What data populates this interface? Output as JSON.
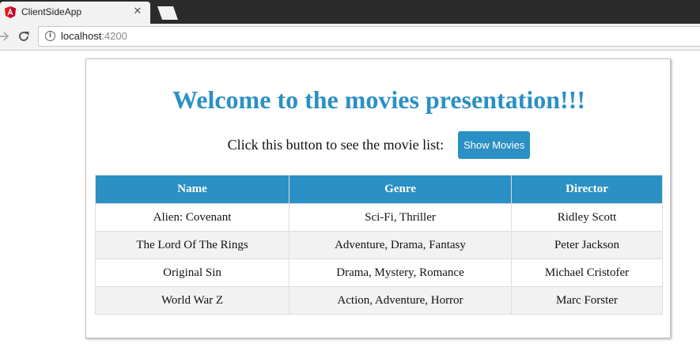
{
  "browser": {
    "tab_title": "ClientSideApp",
    "close_glyph": "✕",
    "url_host": "localhost",
    "url_port": ":4200",
    "info_glyph": "i"
  },
  "page": {
    "title": "Welcome to the movies presentation!!!",
    "prompt": "Click this button to see the movie list:",
    "show_button_label": "Show Movies"
  },
  "table": {
    "headers": [
      "Name",
      "Genre",
      "Director"
    ],
    "rows": [
      [
        "Alien: Covenant",
        "Sci-Fi, Thriller",
        "Ridley Scott"
      ],
      [
        "The Lord Of The Rings",
        "Adventure, Drama, Fantasy",
        "Peter Jackson"
      ],
      [
        "Original Sin",
        "Drama, Mystery, Romance",
        "Michael Cristofer"
      ],
      [
        "World War Z",
        "Action, Adventure, Horror",
        "Marc Forster"
      ]
    ]
  },
  "colors": {
    "accent": "#2b90c3",
    "angular_red": "#dd1b16",
    "row_stripe": "#f2f2f2"
  },
  "icons": [
    "angular-favicon-icon",
    "close-icon",
    "new-tab-icon",
    "forward-arrow-icon",
    "reload-icon",
    "info-icon"
  ]
}
